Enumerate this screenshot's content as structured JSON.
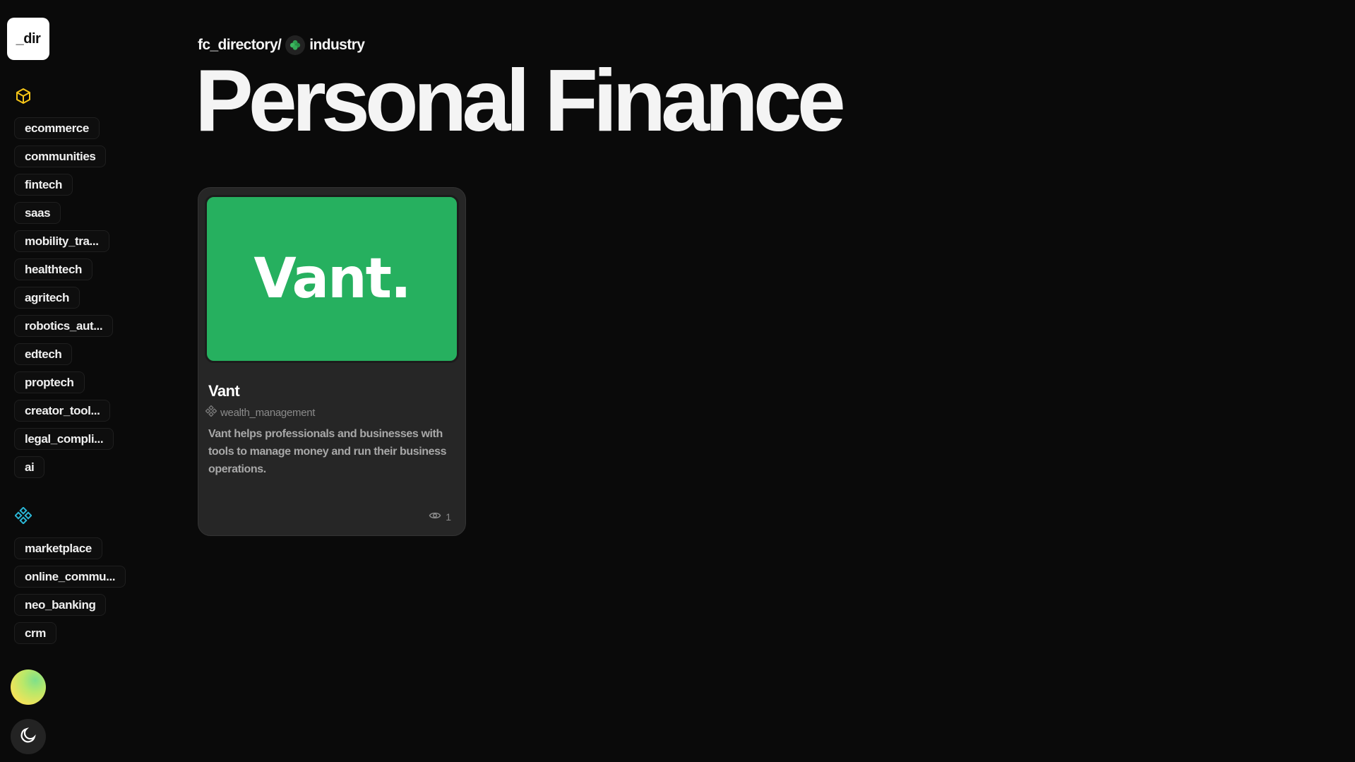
{
  "logo": {
    "text": "_dir"
  },
  "sidebar": {
    "industry_icon": "cube-icon",
    "industries": [
      "ecommerce",
      "communities",
      "fintech",
      "saas",
      "mobility_tra...",
      "healthtech",
      "agritech",
      "robotics_aut...",
      "edtech",
      "proptech",
      "creator_tool...",
      "legal_compli...",
      "ai"
    ],
    "category_icon": "diamond-grid-icon",
    "categories": [
      "marketplace",
      "online_commu...",
      "neo_banking",
      "crm"
    ]
  },
  "breadcrumb": {
    "root": "fc_directory/",
    "icon": "clover-icon",
    "current": "industry"
  },
  "page": {
    "title": "Personal Finance"
  },
  "cards": [
    {
      "logo_text": "Vant.",
      "logo_bg": "#26b05f",
      "name": "Vant",
      "category": "wealth_management",
      "description": "Vant helps professionals and businesses with tools to manage money and run their business operations.",
      "views": "1"
    }
  ],
  "colors": {
    "background": "#0a0a0a",
    "card": "#262626",
    "accent_yellow": "#f5c518",
    "accent_cyan": "#2bb7d6"
  }
}
